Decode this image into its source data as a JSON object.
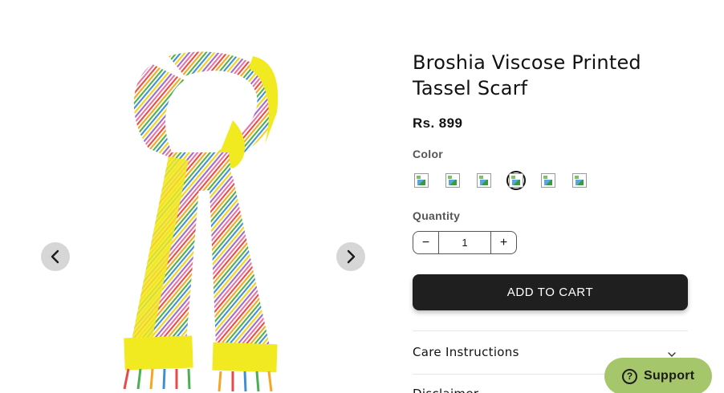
{
  "product": {
    "title": "Broshia Viscose Printed Tassel Scarf",
    "price": "Rs. 899"
  },
  "gallery": {
    "prev_icon": "chevron-left-icon",
    "next_icon": "chevron-right-icon"
  },
  "color": {
    "label": "Color",
    "swatch_count": 6,
    "selected_index": 3
  },
  "quantity": {
    "label": "Quantity",
    "value": "1",
    "decrease_symbol": "−",
    "increase_symbol": "+"
  },
  "cart": {
    "button_label": "ADD TO CART"
  },
  "accordions": [
    {
      "title": "Care Instructions",
      "icon": "chevron-down-icon"
    },
    {
      "title": "Disclaimer"
    }
  ],
  "support": {
    "icon_symbol": "?",
    "label": "Support"
  },
  "colors": {
    "button_dark": "#1f1f1f",
    "support_green": "#a6c66b",
    "scarf_yellow": "#f2ea20"
  }
}
